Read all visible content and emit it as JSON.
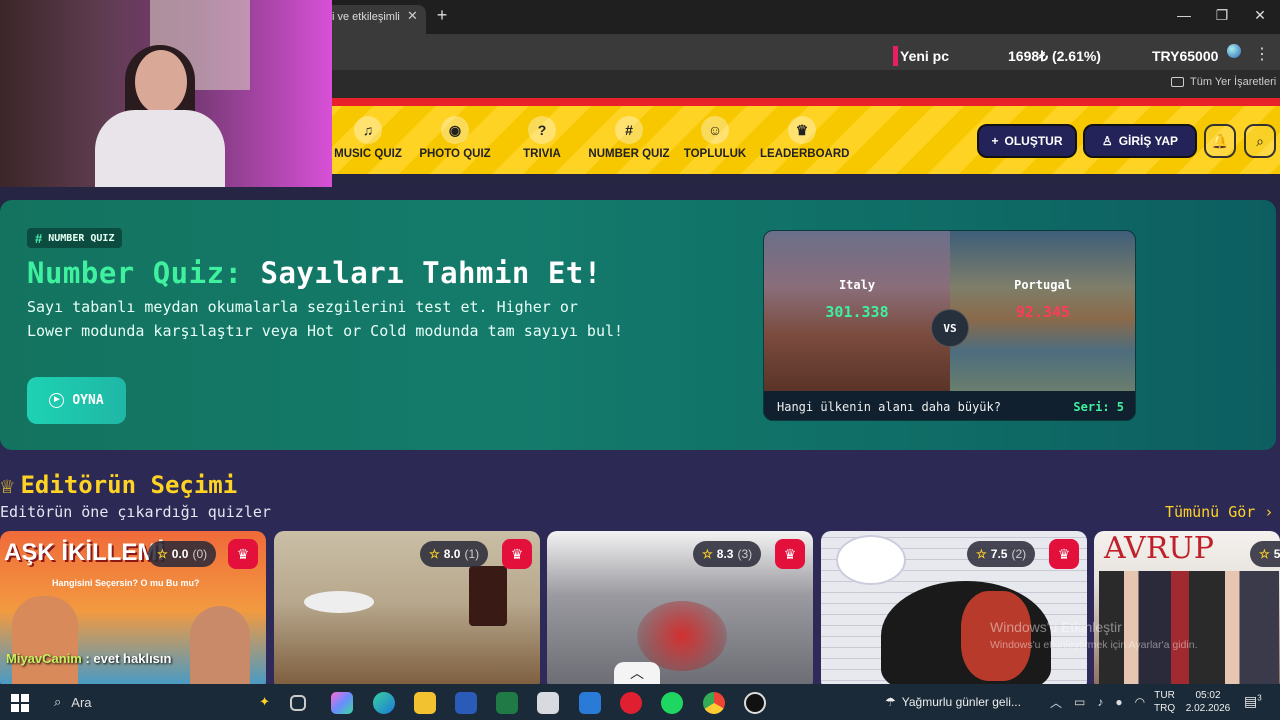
{
  "browser": {
    "tab_title": "i ve etkileşimli",
    "tab_close": "✕",
    "new_tab": "+",
    "win_min": "—",
    "win_max": "❐",
    "win_close": "✕",
    "ticker": {
      "name": "Yeni pc",
      "price": "1698₺ (2.61%)",
      "total": "TRY65000"
    },
    "menu": "⋮",
    "bookmarks_all": "Tüm Yer İşaretleri"
  },
  "nav": {
    "items": [
      {
        "label": "MUSIC QUIZ",
        "icon": "♫"
      },
      {
        "label": "PHOTO QUIZ",
        "icon": "◉"
      },
      {
        "label": "TRIVIA",
        "icon": "?"
      },
      {
        "label": "NUMBER QUIZ",
        "icon": "#"
      },
      {
        "label": "TOPLULUK",
        "icon": "☺"
      },
      {
        "label": "LEADERBOARD",
        "icon": "♛"
      }
    ],
    "create_label": "OLUŞTUR",
    "create_icon": "+",
    "login_label": "GİRİŞ YAP",
    "login_icon": "♙",
    "bell_icon": "🔔",
    "search_icon": "⌕"
  },
  "hero": {
    "tag": "NUMBER QUIZ",
    "tag_icon": "#",
    "title_accent": "Number Quiz:",
    "title_rest": "Sayıları Tahmin Et!",
    "description": "Sayı tabanlı meydan okumalarla sezgilerini test et. Higher or Lower modunda karşılaştır veya Hot or Cold modunda tam sayıyı bul!",
    "play_label": "OYNA",
    "play_icon": "▶"
  },
  "preview": {
    "left_country": "Italy",
    "left_value": "301.338",
    "left_color": "#3ff09e",
    "right_country": "Portugal",
    "right_value": "92.345",
    "right_color": "#ff3b5c",
    "vs": "VS",
    "question": "Hangi ülkenin alanı daha büyük?",
    "streak": "Seri: 5"
  },
  "editors": {
    "title": "Editörün Seçimi",
    "title_icon": "♕",
    "subtitle": "Editörün öne çıkardığı quizler",
    "see_all": "Tümünü Gör ›",
    "cards": [
      {
        "rating": "0.0",
        "count": "(0)"
      },
      {
        "rating": "8.0",
        "count": "(1)"
      },
      {
        "rating": "8.3",
        "count": "(3)"
      },
      {
        "rating": "7.5",
        "count": "(2)"
      },
      {
        "rating": "5.",
        "count": ""
      }
    ],
    "card1_title": "AŞK İKİLLEMİ",
    "card1_sub": "Hangisini Seçersin? O mu Bu mu?",
    "card5_title": "AVRUP"
  },
  "overlay": {
    "chat_user": "MiyavCanim",
    "chat_text": " : evet haklısın",
    "scroll_up": "︿",
    "watermark_1": "Windows'u Etkinleştir",
    "watermark_2": "Windows'u etkinleştirmek için Ayarlar'a gidin."
  },
  "taskbar": {
    "search": "Ara",
    "weather": "Yağmurlu günler geli...",
    "lang_1": "TUR",
    "lang_2": "TRQ",
    "time": "05:02",
    "date": "2.02.2026",
    "notif_count": "3"
  }
}
